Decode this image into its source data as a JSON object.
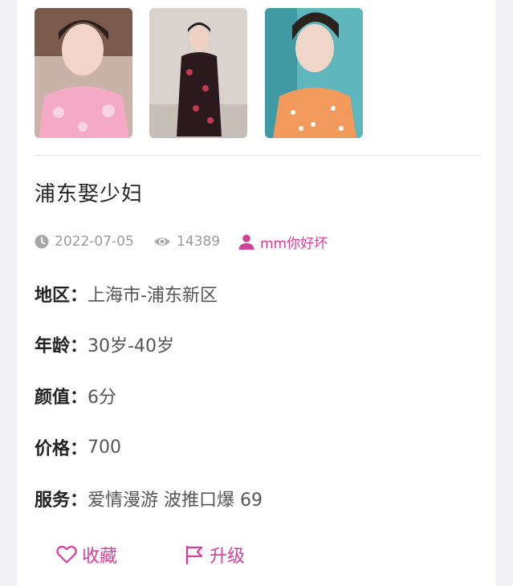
{
  "post": {
    "title": "浦东娶少妇",
    "date": "2022-07-05",
    "views": "14389",
    "author": "mm你好坏"
  },
  "details": [
    {
      "label": "地区：",
      "value": "上海市-浦东新区"
    },
    {
      "label": "年龄：",
      "value": "30岁-40岁"
    },
    {
      "label": "颜值：",
      "value": "6分"
    },
    {
      "label": "价格：",
      "value": "700"
    },
    {
      "label": "服务：",
      "value": "爱情漫游 波推口爆 69"
    }
  ],
  "actions": {
    "favorite_label": "收藏",
    "upgrade_label": "升级"
  },
  "icons": [
    "clock-icon",
    "eye-icon",
    "user-icon",
    "heart-icon",
    "flag-icon"
  ],
  "colors": {
    "accent": "#d6409a",
    "muted": "#9a9a9a"
  }
}
